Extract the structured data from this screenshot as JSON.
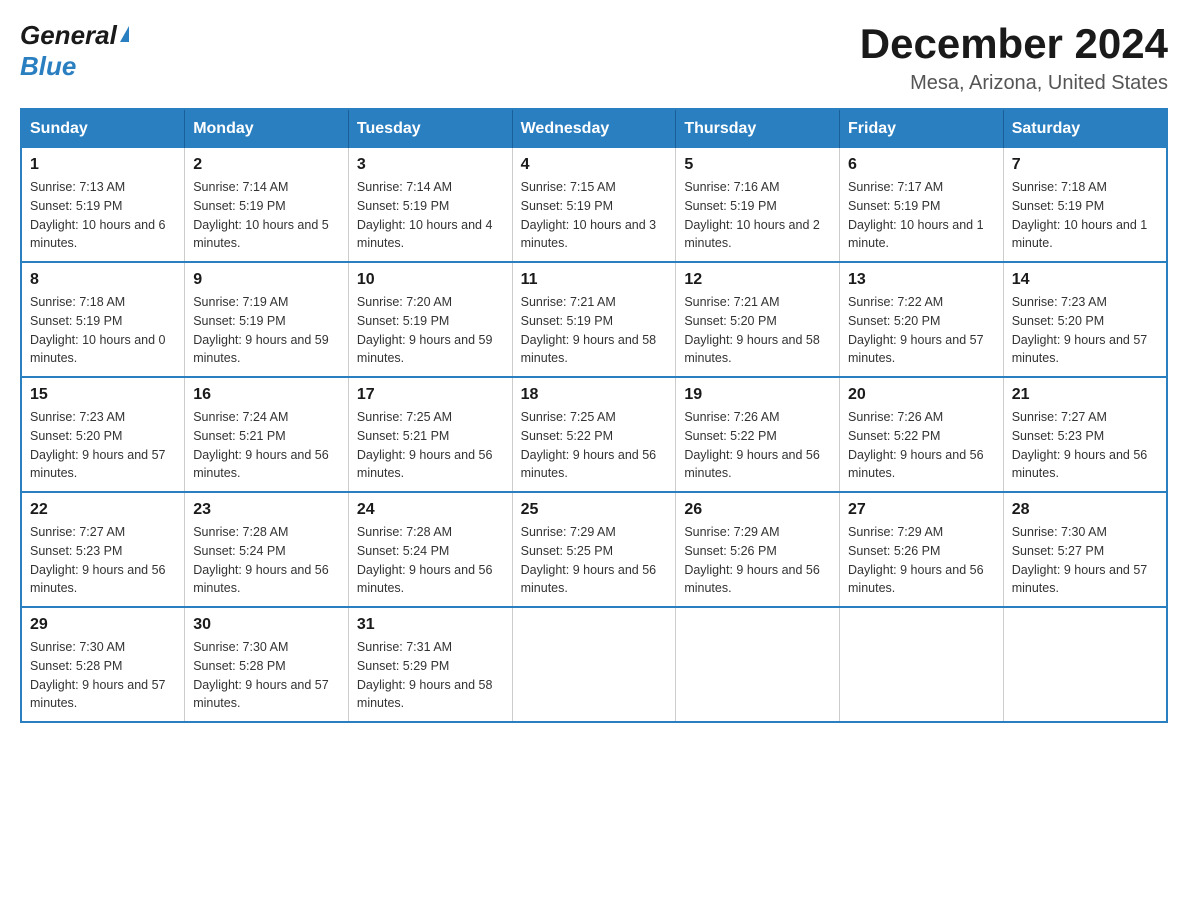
{
  "logo": {
    "general": "General",
    "blue": "Blue",
    "triangle": "▶"
  },
  "title": "December 2024",
  "subtitle": "Mesa, Arizona, United States",
  "days_of_week": [
    "Sunday",
    "Monday",
    "Tuesday",
    "Wednesday",
    "Thursday",
    "Friday",
    "Saturday"
  ],
  "weeks": [
    [
      {
        "day": "1",
        "sunrise": "Sunrise: 7:13 AM",
        "sunset": "Sunset: 5:19 PM",
        "daylight": "Daylight: 10 hours and 6 minutes."
      },
      {
        "day": "2",
        "sunrise": "Sunrise: 7:14 AM",
        "sunset": "Sunset: 5:19 PM",
        "daylight": "Daylight: 10 hours and 5 minutes."
      },
      {
        "day": "3",
        "sunrise": "Sunrise: 7:14 AM",
        "sunset": "Sunset: 5:19 PM",
        "daylight": "Daylight: 10 hours and 4 minutes."
      },
      {
        "day": "4",
        "sunrise": "Sunrise: 7:15 AM",
        "sunset": "Sunset: 5:19 PM",
        "daylight": "Daylight: 10 hours and 3 minutes."
      },
      {
        "day": "5",
        "sunrise": "Sunrise: 7:16 AM",
        "sunset": "Sunset: 5:19 PM",
        "daylight": "Daylight: 10 hours and 2 minutes."
      },
      {
        "day": "6",
        "sunrise": "Sunrise: 7:17 AM",
        "sunset": "Sunset: 5:19 PM",
        "daylight": "Daylight: 10 hours and 1 minute."
      },
      {
        "day": "7",
        "sunrise": "Sunrise: 7:18 AM",
        "sunset": "Sunset: 5:19 PM",
        "daylight": "Daylight: 10 hours and 1 minute."
      }
    ],
    [
      {
        "day": "8",
        "sunrise": "Sunrise: 7:18 AM",
        "sunset": "Sunset: 5:19 PM",
        "daylight": "Daylight: 10 hours and 0 minutes."
      },
      {
        "day": "9",
        "sunrise": "Sunrise: 7:19 AM",
        "sunset": "Sunset: 5:19 PM",
        "daylight": "Daylight: 9 hours and 59 minutes."
      },
      {
        "day": "10",
        "sunrise": "Sunrise: 7:20 AM",
        "sunset": "Sunset: 5:19 PM",
        "daylight": "Daylight: 9 hours and 59 minutes."
      },
      {
        "day": "11",
        "sunrise": "Sunrise: 7:21 AM",
        "sunset": "Sunset: 5:19 PM",
        "daylight": "Daylight: 9 hours and 58 minutes."
      },
      {
        "day": "12",
        "sunrise": "Sunrise: 7:21 AM",
        "sunset": "Sunset: 5:20 PM",
        "daylight": "Daylight: 9 hours and 58 minutes."
      },
      {
        "day": "13",
        "sunrise": "Sunrise: 7:22 AM",
        "sunset": "Sunset: 5:20 PM",
        "daylight": "Daylight: 9 hours and 57 minutes."
      },
      {
        "day": "14",
        "sunrise": "Sunrise: 7:23 AM",
        "sunset": "Sunset: 5:20 PM",
        "daylight": "Daylight: 9 hours and 57 minutes."
      }
    ],
    [
      {
        "day": "15",
        "sunrise": "Sunrise: 7:23 AM",
        "sunset": "Sunset: 5:20 PM",
        "daylight": "Daylight: 9 hours and 57 minutes."
      },
      {
        "day": "16",
        "sunrise": "Sunrise: 7:24 AM",
        "sunset": "Sunset: 5:21 PM",
        "daylight": "Daylight: 9 hours and 56 minutes."
      },
      {
        "day": "17",
        "sunrise": "Sunrise: 7:25 AM",
        "sunset": "Sunset: 5:21 PM",
        "daylight": "Daylight: 9 hours and 56 minutes."
      },
      {
        "day": "18",
        "sunrise": "Sunrise: 7:25 AM",
        "sunset": "Sunset: 5:22 PM",
        "daylight": "Daylight: 9 hours and 56 minutes."
      },
      {
        "day": "19",
        "sunrise": "Sunrise: 7:26 AM",
        "sunset": "Sunset: 5:22 PM",
        "daylight": "Daylight: 9 hours and 56 minutes."
      },
      {
        "day": "20",
        "sunrise": "Sunrise: 7:26 AM",
        "sunset": "Sunset: 5:22 PM",
        "daylight": "Daylight: 9 hours and 56 minutes."
      },
      {
        "day": "21",
        "sunrise": "Sunrise: 7:27 AM",
        "sunset": "Sunset: 5:23 PM",
        "daylight": "Daylight: 9 hours and 56 minutes."
      }
    ],
    [
      {
        "day": "22",
        "sunrise": "Sunrise: 7:27 AM",
        "sunset": "Sunset: 5:23 PM",
        "daylight": "Daylight: 9 hours and 56 minutes."
      },
      {
        "day": "23",
        "sunrise": "Sunrise: 7:28 AM",
        "sunset": "Sunset: 5:24 PM",
        "daylight": "Daylight: 9 hours and 56 minutes."
      },
      {
        "day": "24",
        "sunrise": "Sunrise: 7:28 AM",
        "sunset": "Sunset: 5:24 PM",
        "daylight": "Daylight: 9 hours and 56 minutes."
      },
      {
        "day": "25",
        "sunrise": "Sunrise: 7:29 AM",
        "sunset": "Sunset: 5:25 PM",
        "daylight": "Daylight: 9 hours and 56 minutes."
      },
      {
        "day": "26",
        "sunrise": "Sunrise: 7:29 AM",
        "sunset": "Sunset: 5:26 PM",
        "daylight": "Daylight: 9 hours and 56 minutes."
      },
      {
        "day": "27",
        "sunrise": "Sunrise: 7:29 AM",
        "sunset": "Sunset: 5:26 PM",
        "daylight": "Daylight: 9 hours and 56 minutes."
      },
      {
        "day": "28",
        "sunrise": "Sunrise: 7:30 AM",
        "sunset": "Sunset: 5:27 PM",
        "daylight": "Daylight: 9 hours and 57 minutes."
      }
    ],
    [
      {
        "day": "29",
        "sunrise": "Sunrise: 7:30 AM",
        "sunset": "Sunset: 5:28 PM",
        "daylight": "Daylight: 9 hours and 57 minutes."
      },
      {
        "day": "30",
        "sunrise": "Sunrise: 7:30 AM",
        "sunset": "Sunset: 5:28 PM",
        "daylight": "Daylight: 9 hours and 57 minutes."
      },
      {
        "day": "31",
        "sunrise": "Sunrise: 7:31 AM",
        "sunset": "Sunset: 5:29 PM",
        "daylight": "Daylight: 9 hours and 58 minutes."
      },
      null,
      null,
      null,
      null
    ]
  ]
}
